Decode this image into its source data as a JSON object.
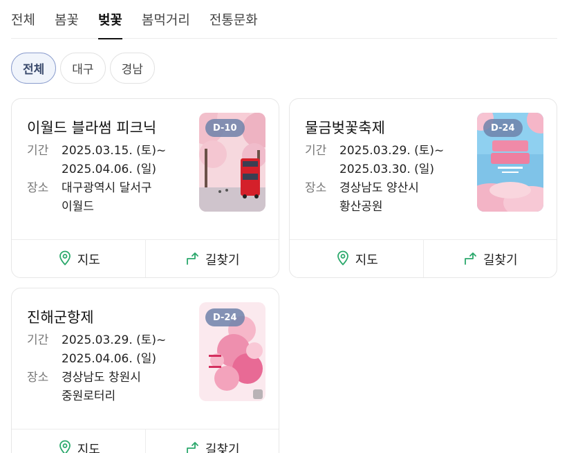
{
  "tabs": [
    {
      "label": "전체"
    },
    {
      "label": "봄꽃"
    },
    {
      "label": "벚꽃"
    },
    {
      "label": "봄먹거리"
    },
    {
      "label": "전통문화"
    }
  ],
  "active_tab": "벚꽃",
  "filters": [
    {
      "label": "전체"
    },
    {
      "label": "대구"
    },
    {
      "label": "경남"
    }
  ],
  "active_filter": "전체",
  "labels": {
    "period": "기간",
    "place": "장소",
    "map": "지도",
    "directions": "길찾기"
  },
  "colors": {
    "accent_green": "#2aa86b",
    "dday_badge": "#6e82aa",
    "active_chip_border": "#8a9ccd"
  },
  "events": [
    {
      "title": "이월드 블라썸 피크닉",
      "period_start": "2025.03.15. (토)~",
      "period_end": "2025.04.06. (일)",
      "place_line1": "대구광역시 달서구",
      "place_line2": "이월드",
      "dday": "D-10"
    },
    {
      "title": "물금벚꽃축제",
      "period_start": "2025.03.29. (토)~",
      "period_end": "2025.03.30. (일)",
      "place_line1": "경상남도 양산시",
      "place_line2": "황산공원",
      "dday": "D-24"
    },
    {
      "title": "진해군항제",
      "period_start": "2025.03.29. (토)~",
      "period_end": "2025.04.06. (일)",
      "place_line1": "경상남도 창원시",
      "place_line2": "중원로터리",
      "dday": "D-24"
    }
  ]
}
